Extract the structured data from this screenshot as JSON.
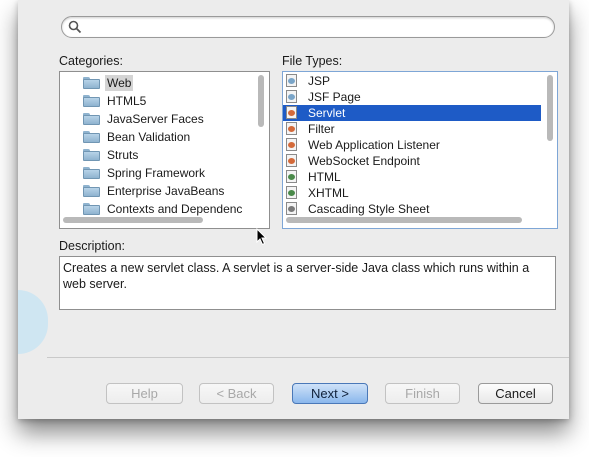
{
  "search": {
    "placeholder": "",
    "value": ""
  },
  "categories": {
    "label": "Categories:",
    "items": [
      {
        "label": "Web",
        "selected": true
      },
      {
        "label": "HTML5"
      },
      {
        "label": "JavaServer Faces"
      },
      {
        "label": "Bean Validation"
      },
      {
        "label": "Struts"
      },
      {
        "label": "Spring Framework"
      },
      {
        "label": "Enterprise JavaBeans"
      },
      {
        "label": "Contexts and Dependenc"
      }
    ]
  },
  "file_types": {
    "label": "File Types:",
    "items": [
      {
        "label": "JSP",
        "icon": "jsp-file-icon"
      },
      {
        "label": "JSF Page",
        "icon": "jsf-file-icon"
      },
      {
        "label": "Servlet",
        "icon": "servlet-file-icon",
        "selected": true
      },
      {
        "label": "Filter",
        "icon": "filter-file-icon"
      },
      {
        "label": "Web Application Listener",
        "icon": "listener-file-icon"
      },
      {
        "label": "WebSocket Endpoint",
        "icon": "websocket-file-icon"
      },
      {
        "label": "HTML",
        "icon": "html-file-icon"
      },
      {
        "label": "XHTML",
        "icon": "xhtml-file-icon"
      },
      {
        "label": "Cascading Style Sheet",
        "icon": "css-file-icon"
      }
    ]
  },
  "description": {
    "label": "Description:",
    "text": "Creates a new servlet class. A servlet is a server-side Java class which runs within a web server."
  },
  "buttons": {
    "help": "Help",
    "back": "< Back",
    "next": "Next >",
    "finish": "Finish",
    "cancel": "Cancel"
  },
  "colors": {
    "selection": "#1e5bc6",
    "window_bg": "#ececec"
  }
}
